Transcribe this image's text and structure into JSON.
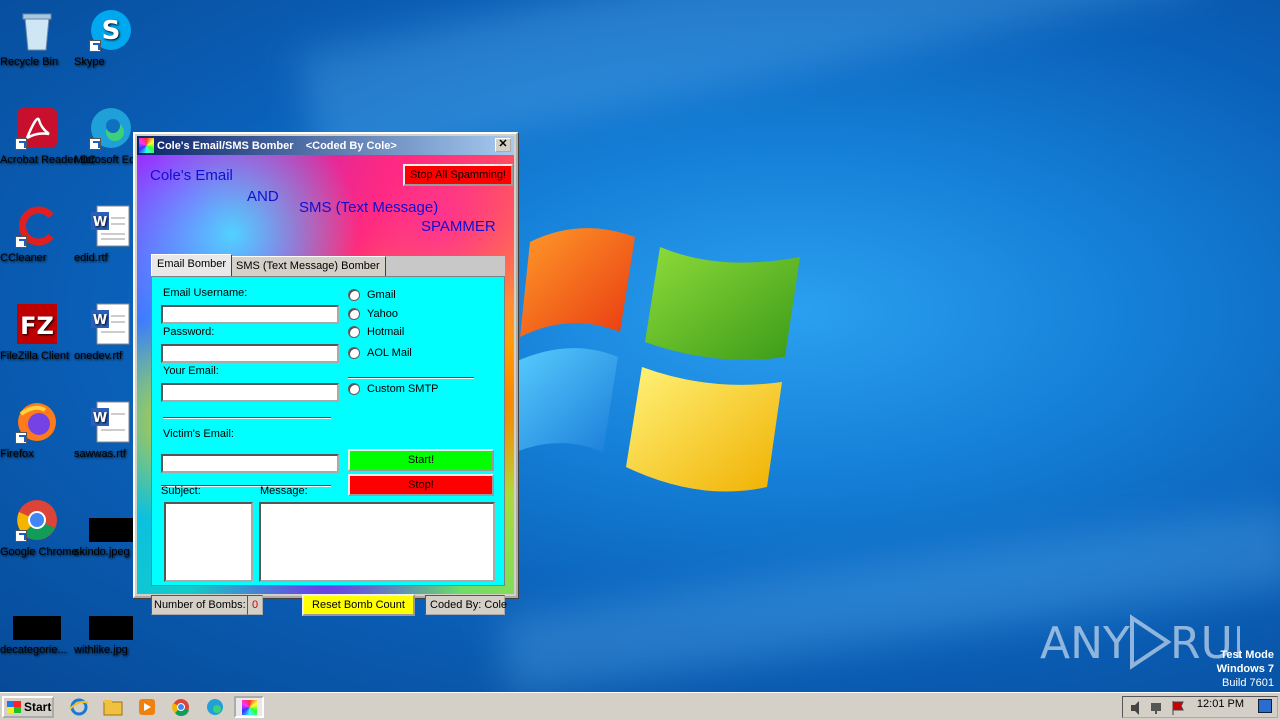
{
  "desktop": {
    "icons": [
      {
        "label": "Recycle Bin"
      },
      {
        "label": "Skype"
      },
      {
        "label": "Acrobat Reader DC"
      },
      {
        "label": "Microsoft Ed"
      },
      {
        "label": "CCleaner"
      },
      {
        "label": "edid.rtf"
      },
      {
        "label": "FileZilla Client"
      },
      {
        "label": "onedev.rtf"
      },
      {
        "label": "Firefox"
      },
      {
        "label": "sawwas.rtf"
      },
      {
        "label": "Google Chrome"
      },
      {
        "label": "skindo.jpeg"
      },
      {
        "label": "decategorie..."
      },
      {
        "label": "withlike.jpg"
      }
    ],
    "watermark": "ANY  RUN",
    "test_mode": {
      "line1": "Test Mode",
      "line2": "Windows 7",
      "line3": "Build 7601"
    }
  },
  "window": {
    "title": "Cole's Email/SMS Bomber    <Coded By Cole>",
    "close_glyph": "✕",
    "banner": {
      "line1": "Cole's Email",
      "line2": "AND",
      "line3": "SMS (Text Message)",
      "line4": "SPAMMER"
    },
    "stop_all_label": "Stop All Spamming!",
    "tabs": [
      {
        "label": "Email Bomber",
        "active": true
      },
      {
        "label": "SMS (Text Message) Bomber",
        "active": false
      }
    ],
    "form": {
      "email_username_label": "Email Username:",
      "email_username_value": "",
      "password_label": "Password:",
      "password_value": "",
      "your_email_label": "Your Email:",
      "your_email_value": "",
      "victim_email_label": "Victim's Email:",
      "victim_email_value": "",
      "subject_label": "Subject:",
      "message_label": "Message:",
      "providers": [
        "Gmail",
        "Yahoo",
        "Hotmail",
        "AOL Mail"
      ],
      "custom_smtp_label": "Custom SMTP",
      "start_label": "Start!",
      "stop_label": "Stop!"
    },
    "status": {
      "bombs_label": "Number of Bombs:",
      "bombs_count": "0",
      "reset_label": "Reset Bomb Count",
      "coded_by": "Coded By: Cole"
    },
    "colors": {
      "panel": "#00ffff",
      "start": "#00ff00",
      "stop": "#ff0000",
      "reset": "#ffff00",
      "banner_text": "#1010d0"
    }
  },
  "taskbar": {
    "start_label": "Start",
    "clock": "12:01 PM"
  }
}
